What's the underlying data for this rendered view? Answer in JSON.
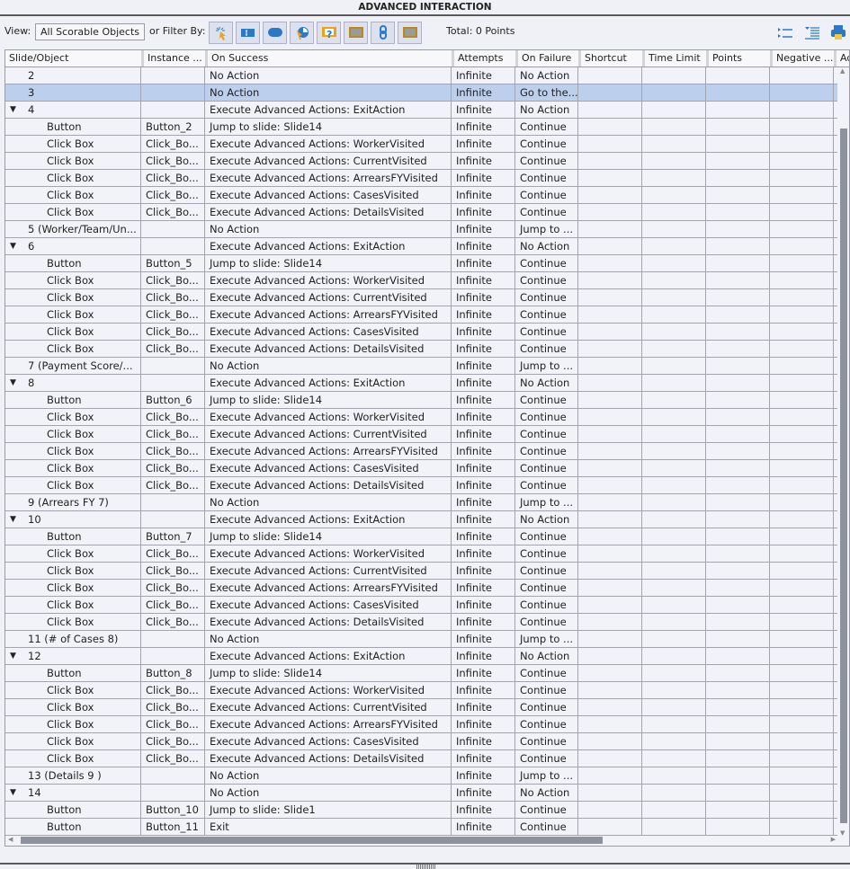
{
  "title": "ADVANCED INTERACTION",
  "toolbar": {
    "view_label": "View:",
    "view_value": "All Scorable Objects",
    "filter_label": "or Filter By:",
    "total": "Total: 0 Points",
    "filters": [
      "highlight-click-icon",
      "text-entry-icon",
      "button-icon",
      "rollover-icon",
      "question-icon",
      "image-icon",
      "link-icon",
      "image-alt-icon"
    ],
    "right_icons": [
      "expand-all-icon",
      "collapse-all-icon",
      "print-icon"
    ]
  },
  "colors": {
    "selected_row": "#bcd0ee",
    "accent": "#2a79c9"
  },
  "columns": [
    "Slide/Object",
    "Instance ...",
    "On Success",
    "Attempts",
    "On Failure",
    "Shortcut",
    "Time Limit",
    "Points",
    "Negative ...",
    "Ad"
  ],
  "rows": [
    {
      "t": "slide",
      "c": [
        "2",
        "",
        "No Action",
        "Infinite",
        "No Action"
      ]
    },
    {
      "t": "slide",
      "sel": true,
      "c": [
        "3",
        "",
        "No Action",
        "Infinite",
        "Go to the..."
      ]
    },
    {
      "t": "group",
      "c": [
        "4",
        "",
        "Execute Advanced Actions: ExitAction",
        "Infinite",
        "No Action"
      ]
    },
    {
      "t": "child",
      "c": [
        "Button",
        "Button_2",
        "Jump to slide: Slide14",
        "Infinite",
        "Continue"
      ]
    },
    {
      "t": "child",
      "c": [
        "Click Box",
        "Click_Bo...",
        "Execute Advanced Actions: WorkerVisited",
        "Infinite",
        "Continue"
      ]
    },
    {
      "t": "child",
      "c": [
        "Click Box",
        "Click_Bo...",
        "Execute Advanced Actions: CurrentVisited",
        "Infinite",
        "Continue"
      ]
    },
    {
      "t": "child",
      "c": [
        "Click Box",
        "Click_Bo...",
        "Execute Advanced Actions: ArrearsFYVisited",
        "Infinite",
        "Continue"
      ]
    },
    {
      "t": "child",
      "c": [
        "Click Box",
        "Click_Bo...",
        "Execute Advanced Actions: CasesVisited",
        "Infinite",
        "Continue"
      ]
    },
    {
      "t": "child",
      "c": [
        "Click Box",
        "Click_Bo...",
        "Execute Advanced Actions: DetailsVisited",
        "Infinite",
        "Continue"
      ]
    },
    {
      "t": "slide",
      "c": [
        "5 (Worker/Team/Un...",
        "",
        "No Action",
        "Infinite",
        "Jump to ..."
      ]
    },
    {
      "t": "group",
      "c": [
        "6",
        "",
        "Execute Advanced Actions: ExitAction",
        "Infinite",
        "No Action"
      ]
    },
    {
      "t": "child",
      "c": [
        "Button",
        "Button_5",
        "Jump to slide: Slide14",
        "Infinite",
        "Continue"
      ]
    },
    {
      "t": "child",
      "c": [
        "Click Box",
        "Click_Bo...",
        "Execute Advanced Actions: WorkerVisited",
        "Infinite",
        "Continue"
      ]
    },
    {
      "t": "child",
      "c": [
        "Click Box",
        "Click_Bo...",
        "Execute Advanced Actions: CurrentVisited",
        "Infinite",
        "Continue"
      ]
    },
    {
      "t": "child",
      "c": [
        "Click Box",
        "Click_Bo...",
        "Execute Advanced Actions: ArrearsFYVisited",
        "Infinite",
        "Continue"
      ]
    },
    {
      "t": "child",
      "c": [
        "Click Box",
        "Click_Bo...",
        "Execute Advanced Actions: CasesVisited",
        "Infinite",
        "Continue"
      ]
    },
    {
      "t": "child",
      "c": [
        "Click Box",
        "Click_Bo...",
        "Execute Advanced Actions: DetailsVisited",
        "Infinite",
        "Continue"
      ]
    },
    {
      "t": "slide",
      "c": [
        "7 (Payment Score/...",
        "",
        "No Action",
        "Infinite",
        "Jump to ..."
      ]
    },
    {
      "t": "group",
      "c": [
        "8",
        "",
        "Execute Advanced Actions: ExitAction",
        "Infinite",
        "No Action"
      ]
    },
    {
      "t": "child",
      "c": [
        "Button",
        "Button_6",
        "Jump to slide: Slide14",
        "Infinite",
        "Continue"
      ]
    },
    {
      "t": "child",
      "c": [
        "Click Box",
        "Click_Bo...",
        "Execute Advanced Actions: WorkerVisited",
        "Infinite",
        "Continue"
      ]
    },
    {
      "t": "child",
      "c": [
        "Click Box",
        "Click_Bo...",
        "Execute Advanced Actions: CurrentVisited",
        "Infinite",
        "Continue"
      ]
    },
    {
      "t": "child",
      "c": [
        "Click Box",
        "Click_Bo...",
        "Execute Advanced Actions: ArrearsFYVisited",
        "Infinite",
        "Continue"
      ]
    },
    {
      "t": "child",
      "c": [
        "Click Box",
        "Click_Bo...",
        "Execute Advanced Actions: CasesVisited",
        "Infinite",
        "Continue"
      ]
    },
    {
      "t": "child",
      "c": [
        "Click Box",
        "Click_Bo...",
        "Execute Advanced Actions: DetailsVisited",
        "Infinite",
        "Continue"
      ]
    },
    {
      "t": "slide",
      "c": [
        "9 (Arrears FY 7)",
        "",
        "No Action",
        "Infinite",
        "Jump to ..."
      ]
    },
    {
      "t": "group",
      "c": [
        "10",
        "",
        "Execute Advanced Actions: ExitAction",
        "Infinite",
        "No Action"
      ]
    },
    {
      "t": "child",
      "c": [
        "Button",
        "Button_7",
        "Jump to slide: Slide14",
        "Infinite",
        "Continue"
      ]
    },
    {
      "t": "child",
      "c": [
        "Click Box",
        "Click_Bo...",
        "Execute Advanced Actions: WorkerVisited",
        "Infinite",
        "Continue"
      ]
    },
    {
      "t": "child",
      "c": [
        "Click Box",
        "Click_Bo...",
        "Execute Advanced Actions: CurrentVisited",
        "Infinite",
        "Continue"
      ]
    },
    {
      "t": "child",
      "c": [
        "Click Box",
        "Click_Bo...",
        "Execute Advanced Actions: ArrearsFYVisited",
        "Infinite",
        "Continue"
      ]
    },
    {
      "t": "child",
      "c": [
        "Click Box",
        "Click_Bo...",
        "Execute Advanced Actions: CasesVisited",
        "Infinite",
        "Continue"
      ]
    },
    {
      "t": "child",
      "c": [
        "Click Box",
        "Click_Bo...",
        "Execute Advanced Actions: DetailsVisited",
        "Infinite",
        "Continue"
      ]
    },
    {
      "t": "slide",
      "c": [
        "11 (# of Cases 8)",
        "",
        "No Action",
        "Infinite",
        "Jump to ..."
      ]
    },
    {
      "t": "group",
      "c": [
        "12",
        "",
        "Execute Advanced Actions: ExitAction",
        "Infinite",
        "No Action"
      ]
    },
    {
      "t": "child",
      "c": [
        "Button",
        "Button_8",
        "Jump to slide: Slide14",
        "Infinite",
        "Continue"
      ]
    },
    {
      "t": "child",
      "c": [
        "Click Box",
        "Click_Bo...",
        "Execute Advanced Actions: WorkerVisited",
        "Infinite",
        "Continue"
      ]
    },
    {
      "t": "child",
      "c": [
        "Click Box",
        "Click_Bo...",
        "Execute Advanced Actions: CurrentVisited",
        "Infinite",
        "Continue"
      ]
    },
    {
      "t": "child",
      "c": [
        "Click Box",
        "Click_Bo...",
        "Execute Advanced Actions: ArrearsFYVisited",
        "Infinite",
        "Continue"
      ]
    },
    {
      "t": "child",
      "c": [
        "Click Box",
        "Click_Bo...",
        "Execute Advanced Actions: CasesVisited",
        "Infinite",
        "Continue"
      ]
    },
    {
      "t": "child",
      "c": [
        "Click Box",
        "Click_Bo...",
        "Execute Advanced Actions: DetailsVisited",
        "Infinite",
        "Continue"
      ]
    },
    {
      "t": "slide",
      "c": [
        "13 (Details 9 )",
        "",
        "No Action",
        "Infinite",
        "Jump to ..."
      ]
    },
    {
      "t": "group",
      "c": [
        "14",
        "",
        "No Action",
        "Infinite",
        "No Action"
      ]
    },
    {
      "t": "child",
      "c": [
        "Button",
        "Button_10",
        "Jump to slide: Slide1",
        "Infinite",
        "Continue"
      ]
    },
    {
      "t": "child",
      "c": [
        "Button",
        "Button_11",
        "Exit",
        "Infinite",
        "Continue"
      ]
    }
  ]
}
